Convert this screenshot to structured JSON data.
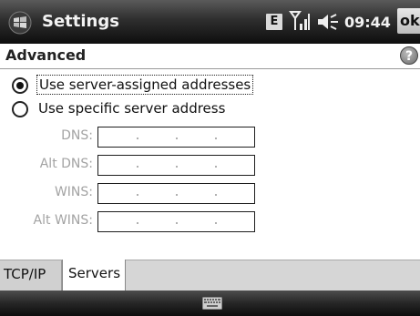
{
  "titlebar": {
    "title": "Settings",
    "network_badge": "E",
    "time": "09:44",
    "ok_label": "ok",
    "icons": [
      "windows-start-icon",
      "signal-icon",
      "speaker-icon"
    ]
  },
  "header": {
    "title": "Advanced",
    "help_label": "?"
  },
  "options": [
    {
      "label": "Use server-assigned addresses",
      "selected": true
    },
    {
      "label": "Use specific server address",
      "selected": false
    }
  ],
  "fields": [
    {
      "label": "DNS:",
      "value": "",
      "disabled": true
    },
    {
      "label": "Alt DNS:",
      "value": "",
      "disabled": true
    },
    {
      "label": "WINS:",
      "value": "",
      "disabled": true
    },
    {
      "label": "Alt WINS:",
      "value": "",
      "disabled": true
    }
  ],
  "tabs": [
    {
      "label": "TCP/IP",
      "active": false
    },
    {
      "label": "Servers",
      "active": true
    }
  ],
  "bottombar": {
    "icon": "keyboard-icon"
  },
  "colors": {
    "titlebar": "#1a1a1a",
    "disabled_label": "#a3a3a3",
    "tabstrip": "#d6d6d6"
  }
}
